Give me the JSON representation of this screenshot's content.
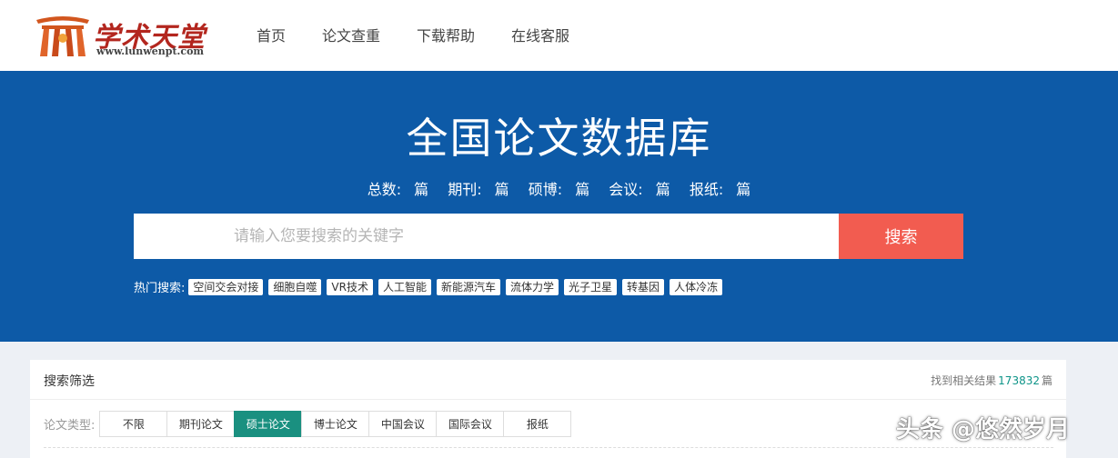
{
  "header": {
    "logo_text": "学术天堂",
    "logo_url": "www.lunwenpt.com",
    "nav": [
      {
        "label": "首页"
      },
      {
        "label": "论文查重"
      },
      {
        "label": "下载帮助"
      },
      {
        "label": "在线客服"
      }
    ]
  },
  "hero": {
    "title": "全国论文数据库",
    "stats": [
      {
        "label": "总数:",
        "unit": "篇"
      },
      {
        "label": "期刊:",
        "unit": "篇"
      },
      {
        "label": "硕博:",
        "unit": "篇"
      },
      {
        "label": "会议:",
        "unit": "篇"
      },
      {
        "label": "报纸:",
        "unit": "篇"
      }
    ],
    "search": {
      "placeholder": "请输入您要搜索的关键字",
      "value": "",
      "button_label": "搜索"
    },
    "hot": {
      "label": "热门搜索:",
      "tags": [
        "空间交会对接",
        "细胞自噬",
        "VR技术",
        "人工智能",
        "新能源汽车",
        "流体力学",
        "光子卫星",
        "转基因",
        "人体冷冻"
      ]
    }
  },
  "filter": {
    "title": "搜索筛选",
    "result_prefix": "找到相关结果",
    "result_count": "173832",
    "result_suffix": "篇",
    "type_label": "论文类型:",
    "types": [
      {
        "label": "不限",
        "active": false
      },
      {
        "label": "期刊论文",
        "active": false
      },
      {
        "label": "硕士论文",
        "active": true
      },
      {
        "label": "博士论文",
        "active": false
      },
      {
        "label": "中国会议",
        "active": false
      },
      {
        "label": "国际会议",
        "active": false
      },
      {
        "label": "报纸",
        "active": false
      }
    ]
  },
  "watermark": "头条 @悠然岁月",
  "colors": {
    "hero_bg": "#0d5aa7",
    "search_button": "#f25c50",
    "active_type": "#1a9080",
    "logo_red": "#b3261e"
  }
}
